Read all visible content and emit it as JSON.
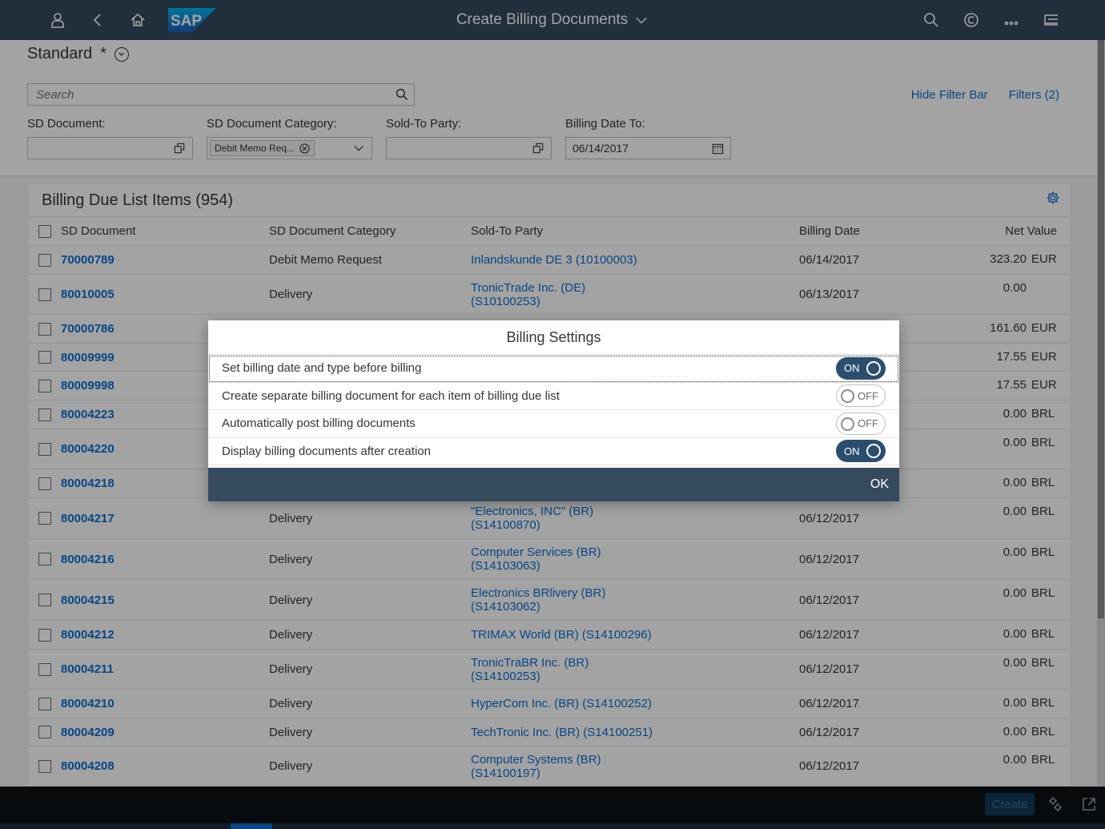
{
  "shell": {
    "title": "Create Billing Documents",
    "logo_text": "SAP",
    "icons": [
      "user-icon",
      "back-icon",
      "home-icon",
      "search-icon",
      "copilot-icon",
      "more-icon",
      "notifications-icon"
    ]
  },
  "variant": {
    "name": "Standard",
    "modified": "*"
  },
  "filter": {
    "search_placeholder": "Search",
    "hide_filter_bar": "Hide Filter Bar",
    "filters": "Filters (2)",
    "fields": [
      {
        "label": "SD Document:",
        "value": ""
      },
      {
        "label": "SD Document Category:",
        "token": "Debit Memo Req..."
      },
      {
        "label": "Sold-To Party:",
        "value": ""
      },
      {
        "label": "Billing Date To:",
        "value": "06/14/2017"
      }
    ]
  },
  "table": {
    "title": "Billing Due List Items (954)",
    "columns": [
      "SD Document",
      "SD Document Category",
      "Sold-To Party",
      "Billing Date",
      "Net Value"
    ],
    "rows": [
      {
        "doc": "70000789",
        "cat": "Debit Memo Request",
        "party": [
          "Inlandskunde DE 3 (10100003)"
        ],
        "date": "06/14/2017",
        "value": "323.20",
        "cur": "EUR"
      },
      {
        "doc": "80010005",
        "cat": "Delivery",
        "party": [
          "TronicTrade Inc. (DE)",
          "(S10100253)"
        ],
        "date": "06/13/2017",
        "value": "0.00",
        "cur": ""
      },
      {
        "doc": "70000786",
        "cat": "",
        "party": [
          ""
        ],
        "date": "",
        "value": "161.60",
        "cur": "EUR"
      },
      {
        "doc": "80009999",
        "cat": "",
        "party": [
          ""
        ],
        "date": "",
        "value": "17.55",
        "cur": "EUR"
      },
      {
        "doc": "80009998",
        "cat": "",
        "party": [
          ""
        ],
        "date": "",
        "value": "17.55",
        "cur": "EUR"
      },
      {
        "doc": "80004223",
        "cat": "",
        "party": [
          ""
        ],
        "date": "",
        "value": "0.00",
        "cur": "BRL"
      },
      {
        "doc": "80004220",
        "cat": "",
        "party": [
          "",
          ""
        ],
        "date": "",
        "value": "0.00",
        "cur": "BRL"
      },
      {
        "doc": "80004218",
        "cat": "",
        "party": [
          "",
          ""
        ],
        "date": "",
        "value": "0.00",
        "cur": "BRL"
      },
      {
        "doc": "80004217",
        "cat": "Delivery",
        "party": [
          "\"Electronics, INC\" (BR)",
          "(S14100870)"
        ],
        "date": "06/12/2017",
        "value": "0.00",
        "cur": "BRL"
      },
      {
        "doc": "80004216",
        "cat": "Delivery",
        "party": [
          "Computer Services (BR)",
          "(S14103063)"
        ],
        "date": "06/12/2017",
        "value": "0.00",
        "cur": "BRL"
      },
      {
        "doc": "80004215",
        "cat": "Delivery",
        "party": [
          "Electronics BRlivery (BR)",
          "(S14103062)"
        ],
        "date": "06/12/2017",
        "value": "0.00",
        "cur": "BRL"
      },
      {
        "doc": "80004212",
        "cat": "Delivery",
        "party": [
          "TRIMAX World (BR) (S14100296)"
        ],
        "date": "06/12/2017",
        "value": "0.00",
        "cur": "BRL"
      },
      {
        "doc": "80004211",
        "cat": "Delivery",
        "party": [
          "TronicTraBR Inc. (BR)",
          "(S14100253)"
        ],
        "date": "06/12/2017",
        "value": "0.00",
        "cur": "BRL"
      },
      {
        "doc": "80004210",
        "cat": "Delivery",
        "party": [
          "HyperCom Inc. (BR) (S14100252)"
        ],
        "date": "06/12/2017",
        "value": "0.00",
        "cur": "BRL"
      },
      {
        "doc": "80004209",
        "cat": "Delivery",
        "party": [
          "TechTronic Inc. (BR) (S14100251)"
        ],
        "date": "06/12/2017",
        "value": "0.00",
        "cur": "BRL"
      },
      {
        "doc": "80004208",
        "cat": "Delivery",
        "party": [
          "Computer Systems (BR)",
          "(S14100197)"
        ],
        "date": "06/12/2017",
        "value": "0.00",
        "cur": "BRL"
      }
    ]
  },
  "footer": {
    "create_label": "Create"
  },
  "dialog": {
    "title": "Billing Settings",
    "settings": [
      {
        "label": "Set billing date and type before billing",
        "state": "ON",
        "on": true
      },
      {
        "label": "Create separate billing document for each item of billing due list",
        "state": "OFF",
        "on": false
      },
      {
        "label": "Automatically post billing documents",
        "state": "OFF",
        "on": false
      },
      {
        "label": "Display billing documents after creation",
        "state": "ON",
        "on": true
      }
    ],
    "ok_label": "OK"
  }
}
